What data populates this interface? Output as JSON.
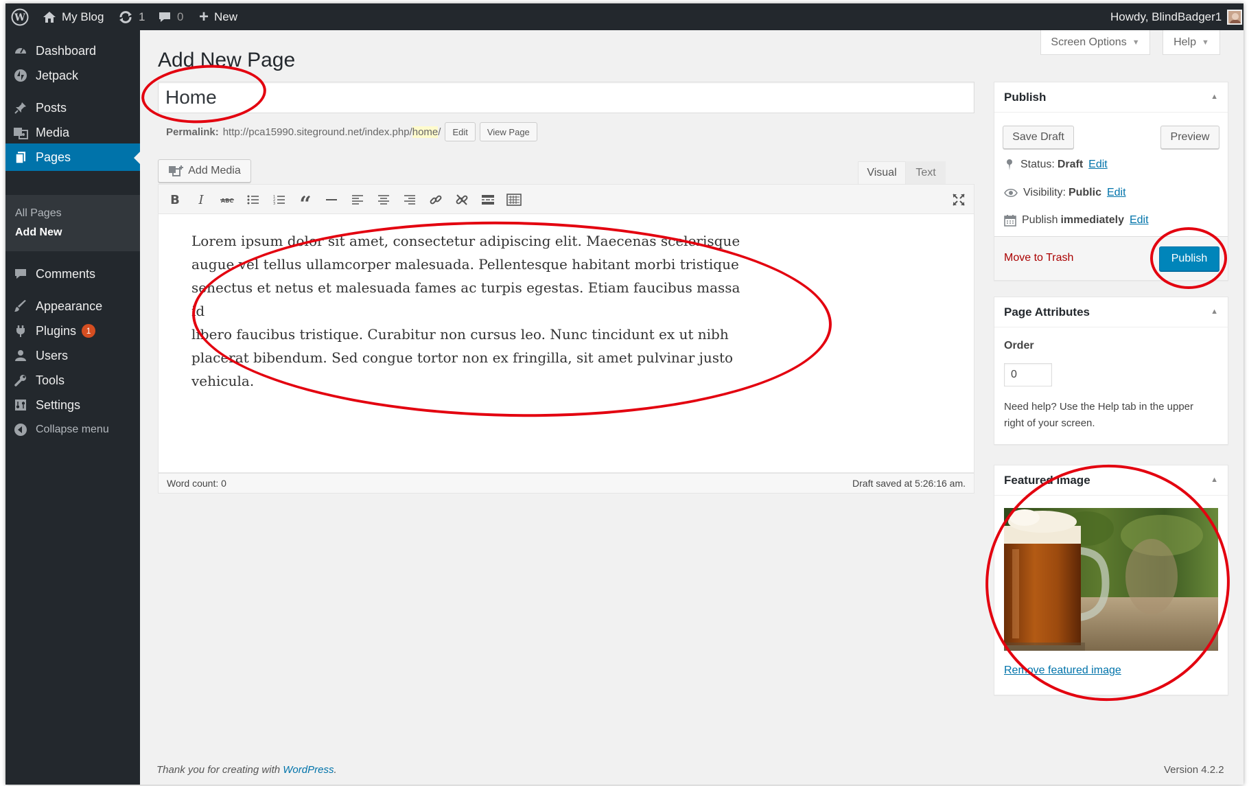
{
  "colors": {
    "accent": "#0073aa",
    "primary_button": "#0085ba",
    "admin_bar": "#23282d",
    "annotation": "#e3000f"
  },
  "adminbar": {
    "site_name": "My Blog",
    "updates_count": "1",
    "comments_count": "0",
    "new_label": "New",
    "howdy": "Howdy, BlindBadger1"
  },
  "sidebar": {
    "items": [
      {
        "label": "Dashboard",
        "icon": "dashboard-icon"
      },
      {
        "label": "Jetpack",
        "icon": "jetpack-icon"
      },
      {
        "label": "Posts",
        "icon": "pin-icon"
      },
      {
        "label": "Media",
        "icon": "media-icon"
      },
      {
        "label": "Pages",
        "icon": "pages-icon"
      },
      {
        "label": "Comments",
        "icon": "comment-icon"
      },
      {
        "label": "Appearance",
        "icon": "brush-icon"
      },
      {
        "label": "Plugins",
        "icon": "plugin-icon",
        "badge": "1"
      },
      {
        "label": "Users",
        "icon": "user-icon"
      },
      {
        "label": "Tools",
        "icon": "wrench-icon"
      },
      {
        "label": "Settings",
        "icon": "settings-icon"
      },
      {
        "label": "Collapse menu",
        "icon": "collapse-icon"
      }
    ],
    "submenu": [
      "All Pages",
      "Add New"
    ]
  },
  "screen_options_label": "Screen Options",
  "help_label": "Help",
  "page_heading": "Add New Page",
  "title_value": "Home",
  "permalink": {
    "label": "Permalink:",
    "base": "http://pca15990.siteground.net/index.php/",
    "slug": "home",
    "trail": "/",
    "edit_label": "Edit",
    "view_label": "View Page"
  },
  "editor": {
    "add_media_label": "Add Media",
    "tab_visual": "Visual",
    "tab_text": "Text",
    "content_lines": [
      "Lorem ipsum dolor sit amet, consectetur adipiscing elit. Maecenas scelerisque",
      "augue vel tellus ullamcorper malesuada. Pellentesque habitant morbi tristique",
      "senectus et netus et malesuada fames ac turpis egestas. Etiam faucibus massa id",
      "libero faucibus tristique. Curabitur non cursus leo. Nunc tincidunt ex ut nibh",
      "placerat bibendum. Sed congue tortor non ex fringilla, sit amet pulvinar justo",
      "vehicula."
    ],
    "word_count": "Word count: 0",
    "draft_saved": "Draft saved at 5:26:16 am."
  },
  "publish_box": {
    "title": "Publish",
    "save_draft": "Save Draft",
    "preview": "Preview",
    "status_label": "Status:",
    "status_value": "Draft",
    "visibility_label": "Visibility:",
    "visibility_value": "Public",
    "publish_label": "Publish",
    "publish_value": "immediately",
    "edit_label": "Edit",
    "trash_label": "Move to Trash",
    "publish_button": "Publish"
  },
  "page_attributes": {
    "title": "Page Attributes",
    "order_label": "Order",
    "order_value": "0",
    "help_text_1": "Need help? Use the Help tab in the upper",
    "help_text_2": "right of your screen."
  },
  "featured_image": {
    "title": "Featured Image",
    "remove_label": "Remove featured image"
  },
  "footer": {
    "thanks": "Thank you for creating with ",
    "wp_link": "WordPress",
    "period": ".",
    "version": "Version 4.2.2"
  }
}
